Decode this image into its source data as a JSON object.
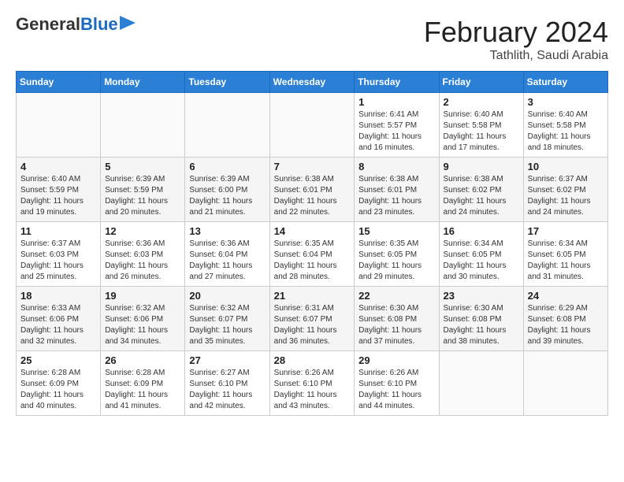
{
  "header": {
    "logo_line1": "General",
    "logo_line2": "Blue",
    "title": "February 2024",
    "subtitle": "Tathlith, Saudi Arabia"
  },
  "days_of_week": [
    "Sunday",
    "Monday",
    "Tuesday",
    "Wednesday",
    "Thursday",
    "Friday",
    "Saturday"
  ],
  "weeks": [
    [
      {
        "day": "",
        "info": ""
      },
      {
        "day": "",
        "info": ""
      },
      {
        "day": "",
        "info": ""
      },
      {
        "day": "",
        "info": ""
      },
      {
        "day": "1",
        "info": "Sunrise: 6:41 AM\nSunset: 5:57 PM\nDaylight: 11 hours\nand 16 minutes."
      },
      {
        "day": "2",
        "info": "Sunrise: 6:40 AM\nSunset: 5:58 PM\nDaylight: 11 hours\nand 17 minutes."
      },
      {
        "day": "3",
        "info": "Sunrise: 6:40 AM\nSunset: 5:58 PM\nDaylight: 11 hours\nand 18 minutes."
      }
    ],
    [
      {
        "day": "4",
        "info": "Sunrise: 6:40 AM\nSunset: 5:59 PM\nDaylight: 11 hours\nand 19 minutes."
      },
      {
        "day": "5",
        "info": "Sunrise: 6:39 AM\nSunset: 5:59 PM\nDaylight: 11 hours\nand 20 minutes."
      },
      {
        "day": "6",
        "info": "Sunrise: 6:39 AM\nSunset: 6:00 PM\nDaylight: 11 hours\nand 21 minutes."
      },
      {
        "day": "7",
        "info": "Sunrise: 6:38 AM\nSunset: 6:01 PM\nDaylight: 11 hours\nand 22 minutes."
      },
      {
        "day": "8",
        "info": "Sunrise: 6:38 AM\nSunset: 6:01 PM\nDaylight: 11 hours\nand 23 minutes."
      },
      {
        "day": "9",
        "info": "Sunrise: 6:38 AM\nSunset: 6:02 PM\nDaylight: 11 hours\nand 24 minutes."
      },
      {
        "day": "10",
        "info": "Sunrise: 6:37 AM\nSunset: 6:02 PM\nDaylight: 11 hours\nand 24 minutes."
      }
    ],
    [
      {
        "day": "11",
        "info": "Sunrise: 6:37 AM\nSunset: 6:03 PM\nDaylight: 11 hours\nand 25 minutes."
      },
      {
        "day": "12",
        "info": "Sunrise: 6:36 AM\nSunset: 6:03 PM\nDaylight: 11 hours\nand 26 minutes."
      },
      {
        "day": "13",
        "info": "Sunrise: 6:36 AM\nSunset: 6:04 PM\nDaylight: 11 hours\nand 27 minutes."
      },
      {
        "day": "14",
        "info": "Sunrise: 6:35 AM\nSunset: 6:04 PM\nDaylight: 11 hours\nand 28 minutes."
      },
      {
        "day": "15",
        "info": "Sunrise: 6:35 AM\nSunset: 6:05 PM\nDaylight: 11 hours\nand 29 minutes."
      },
      {
        "day": "16",
        "info": "Sunrise: 6:34 AM\nSunset: 6:05 PM\nDaylight: 11 hours\nand 30 minutes."
      },
      {
        "day": "17",
        "info": "Sunrise: 6:34 AM\nSunset: 6:05 PM\nDaylight: 11 hours\nand 31 minutes."
      }
    ],
    [
      {
        "day": "18",
        "info": "Sunrise: 6:33 AM\nSunset: 6:06 PM\nDaylight: 11 hours\nand 32 minutes."
      },
      {
        "day": "19",
        "info": "Sunrise: 6:32 AM\nSunset: 6:06 PM\nDaylight: 11 hours\nand 34 minutes."
      },
      {
        "day": "20",
        "info": "Sunrise: 6:32 AM\nSunset: 6:07 PM\nDaylight: 11 hours\nand 35 minutes."
      },
      {
        "day": "21",
        "info": "Sunrise: 6:31 AM\nSunset: 6:07 PM\nDaylight: 11 hours\nand 36 minutes."
      },
      {
        "day": "22",
        "info": "Sunrise: 6:30 AM\nSunset: 6:08 PM\nDaylight: 11 hours\nand 37 minutes."
      },
      {
        "day": "23",
        "info": "Sunrise: 6:30 AM\nSunset: 6:08 PM\nDaylight: 11 hours\nand 38 minutes."
      },
      {
        "day": "24",
        "info": "Sunrise: 6:29 AM\nSunset: 6:08 PM\nDaylight: 11 hours\nand 39 minutes."
      }
    ],
    [
      {
        "day": "25",
        "info": "Sunrise: 6:28 AM\nSunset: 6:09 PM\nDaylight: 11 hours\nand 40 minutes."
      },
      {
        "day": "26",
        "info": "Sunrise: 6:28 AM\nSunset: 6:09 PM\nDaylight: 11 hours\nand 41 minutes."
      },
      {
        "day": "27",
        "info": "Sunrise: 6:27 AM\nSunset: 6:10 PM\nDaylight: 11 hours\nand 42 minutes."
      },
      {
        "day": "28",
        "info": "Sunrise: 6:26 AM\nSunset: 6:10 PM\nDaylight: 11 hours\nand 43 minutes."
      },
      {
        "day": "29",
        "info": "Sunrise: 6:26 AM\nSunset: 6:10 PM\nDaylight: 11 hours\nand 44 minutes."
      },
      {
        "day": "",
        "info": ""
      },
      {
        "day": "",
        "info": ""
      }
    ]
  ]
}
